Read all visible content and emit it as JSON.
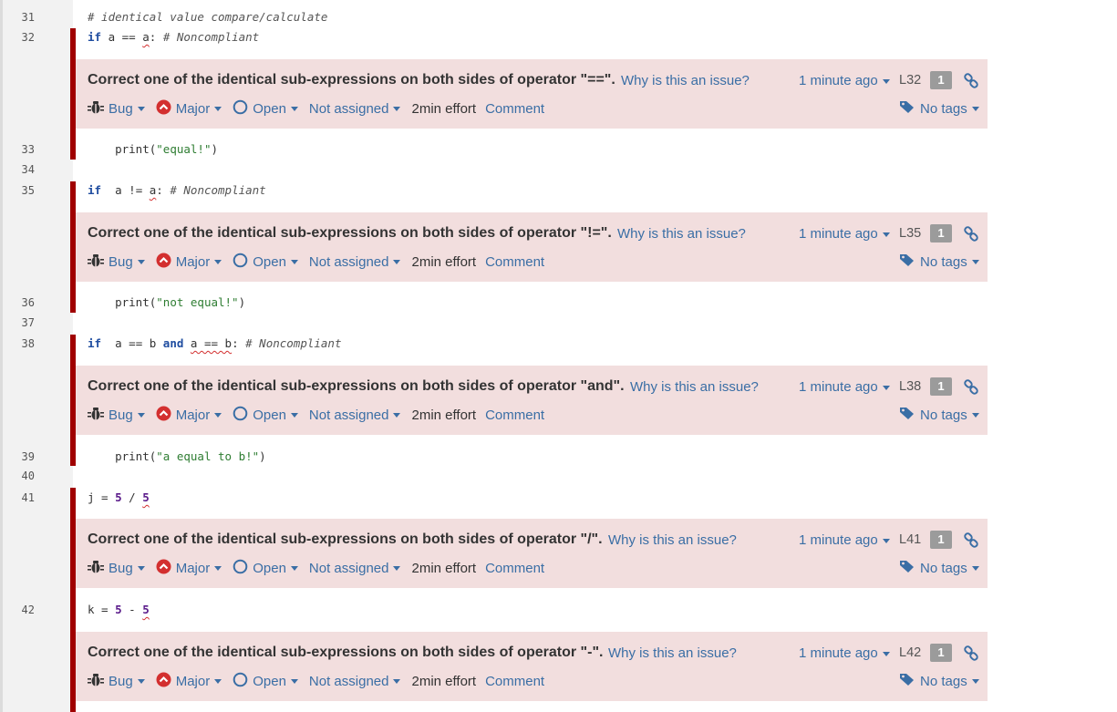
{
  "colors": {
    "accent": "#3a6ea5",
    "issue_bg": "#f2dede",
    "marker": "#a00000",
    "severity": "#d32f2f"
  },
  "code_lines": {
    "l31": {
      "num": "31",
      "comment": "# identical value compare/calculate"
    },
    "l32": {
      "num": "32",
      "kw": "if",
      "pre": " a == ",
      "sq": "a",
      "post": ": ",
      "comment": "# Noncompliant"
    },
    "l33": {
      "num": "33",
      "indent": "    print(",
      "str": "\"equal!\"",
      "close": ")"
    },
    "l34": {
      "num": "34"
    },
    "l35": {
      "num": "35",
      "kw": "if",
      "pre": "  a != ",
      "sq": "a",
      "post": ": ",
      "comment": "# Noncompliant"
    },
    "l36": {
      "num": "36",
      "indent": "    print(",
      "str": "\"not equal!\"",
      "close": ")"
    },
    "l37": {
      "num": "37"
    },
    "l38": {
      "num": "38",
      "kw": "if",
      "pre": "  a == b ",
      "kw2": "and",
      "sp": " ",
      "sq": "a == b",
      "post": ": ",
      "comment": "# Noncompliant"
    },
    "l39": {
      "num": "39",
      "indent": "    print(",
      "str": "\"a equal to b!\"",
      "close": ")"
    },
    "l40": {
      "num": "40"
    },
    "l41": {
      "num": "41",
      "pre": "j = ",
      "n1": "5",
      "op": " / ",
      "sq": "5"
    },
    "l42": {
      "num": "42",
      "pre": "k = ",
      "n1": "5",
      "op": " - ",
      "sq": "5"
    }
  },
  "issue_labels": {
    "why": "Why is this an issue?",
    "age": "1 minute ago",
    "count": "1",
    "type": "Bug",
    "severity": "Major",
    "status": "Open",
    "assignee": "Not assigned",
    "effort": "2min effort",
    "comment": "Comment",
    "tags": "No tags"
  },
  "issues": [
    {
      "message": "Correct one of the identical sub-expressions on both sides of operator \"==\".",
      "line": "L32"
    },
    {
      "message": "Correct one of the identical sub-expressions on both sides of operator \"!=\".",
      "line": "L35"
    },
    {
      "message": "Correct one of the identical sub-expressions on both sides of operator \"and\".",
      "line": "L38"
    },
    {
      "message": "Correct one of the identical sub-expressions on both sides of operator \"/\".",
      "line": "L41"
    },
    {
      "message": "Correct one of the identical sub-expressions on both sides of operator \"-\".",
      "line": "L42"
    }
  ]
}
